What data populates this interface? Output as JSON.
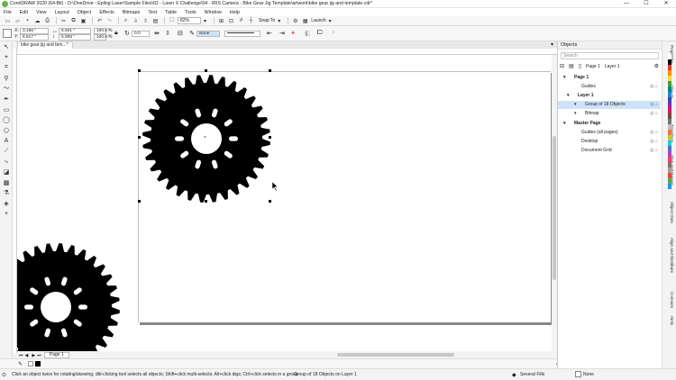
{
  "window": {
    "title": "CorelDRAW 2020 (64-Bit) - D:\\OneDrive - Epilog Laser\\Sample Files\\02 - Laser X Challenge\\04 - IRIS Camera - Bike Gear Jig Template\\artwork\\bike gear jig and template.cdr*",
    "minimize": "—",
    "maximize": "☐",
    "close": "✕"
  },
  "menu": [
    "File",
    "Edit",
    "View",
    "Layout",
    "Object",
    "Effects",
    "Bitmaps",
    "Text",
    "Table",
    "Tools",
    "Window",
    "Help"
  ],
  "standard_toolbar": {
    "zoom": "82%",
    "snap_to": "Snap To",
    "launch": "Launch"
  },
  "property_bar": {
    "x_label": "X:",
    "x_value": "3.186 \"",
    "y_label": "Y:",
    "y_value": "6.817 \"",
    "w_value": "5.921 \"",
    "h_value": "5.906 \"",
    "scale_w": "100.0",
    "scale_h": "100.0",
    "percent": "%",
    "rotation": "0.0",
    "outline_width": "None"
  },
  "document_tab": "bike gear jig and tem...*",
  "page_tab": "Page 1",
  "docker": {
    "title": "Objects",
    "search_placeholder": "Search",
    "current_page": "Page 1",
    "current_layer": "Layer 1",
    "tree": [
      {
        "label": "Page 1",
        "indent": 0,
        "bold": true
      },
      {
        "label": "Guides",
        "indent": 2,
        "bold": false
      },
      {
        "label": "Layer 1",
        "indent": 1,
        "bold": true
      },
      {
        "label": "Group of 18 Objects",
        "indent": 3,
        "bold": false,
        "selected": true
      },
      {
        "label": "Bitmap",
        "indent": 3,
        "bold": false
      },
      {
        "label": "Master Page",
        "indent": 0,
        "bold": true
      },
      {
        "label": "Guides (all pages)",
        "indent": 2,
        "bold": false
      },
      {
        "label": "Desktop",
        "indent": 2,
        "bold": false
      },
      {
        "label": "Document Grid",
        "indent": 2,
        "bold": false
      }
    ]
  },
  "right_tabs": [
    "Properties",
    "Objects",
    "Transform",
    "Step and Repeat",
    "Object Data",
    "Align and Distribute",
    "Contours",
    "Hints"
  ],
  "status": {
    "hint": "Click an object twice for rotating/skewing; dbl-clicking tool selects all objects; Shift+click multi-selects; Alt+click digs; Ctrl+click selects in a group",
    "selection": "Group of 18 Objects on Layer 1",
    "fill": "Several Fills",
    "outline": "None"
  },
  "palette_colors": [
    "#ffffff",
    "#000000",
    "#e53935",
    "#fb8c00",
    "#fdd835",
    "#43a047",
    "#00897b",
    "#1e88e5",
    "#3949ab",
    "#8e24aa",
    "#d81b60",
    "#6d4c41",
    "#757575",
    "#bdbdbd",
    "#ff7043",
    "#c0ca33",
    "#26c6da",
    "#5c6bc0",
    "#ab47bc",
    "#ec407a",
    "#8d6e63",
    "#9e9e9e",
    "#f44336",
    "#4caf50",
    "#2196f3"
  ]
}
